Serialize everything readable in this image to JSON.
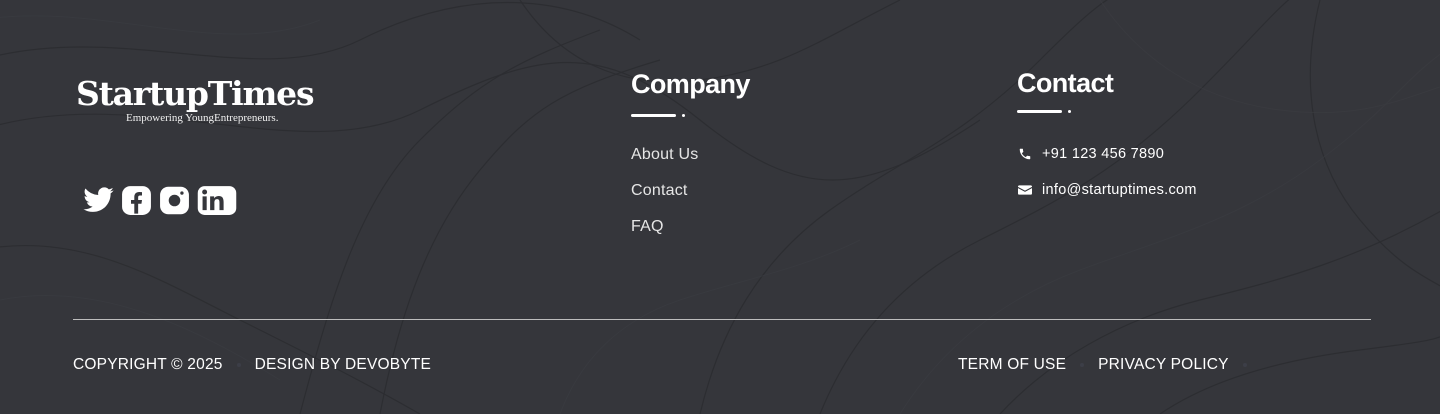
{
  "brand": {
    "name": "StartupTimes",
    "tagline": "Empowering YoungEntrepreneurs."
  },
  "social": [
    {
      "icon": "twitter-icon",
      "label": "Twitter"
    },
    {
      "icon": "facebook-icon",
      "label": "Facebook"
    },
    {
      "icon": "instagram-icon",
      "label": "Instagram"
    },
    {
      "icon": "linkedin-icon",
      "label": "LinkedIn"
    }
  ],
  "company": {
    "title": "Company",
    "links": [
      "About Us",
      "Contact",
      "FAQ"
    ]
  },
  "contact": {
    "title": "Contact",
    "phone": "+91 123 456 7890",
    "email": "info@startuptimes.com",
    "phone_icon": "phone-icon",
    "email_icon": "envelope-icon"
  },
  "bottom": {
    "copyright": "COPYRIGHT © 2025",
    "design": "DESIGN BY DEVOBYTE",
    "terms": "TERM OF USE",
    "privacy": "PRIVACY POLICY"
  },
  "colors": {
    "background": "#35363b",
    "text": "#ffffff",
    "divider": "#bdbdbd"
  }
}
